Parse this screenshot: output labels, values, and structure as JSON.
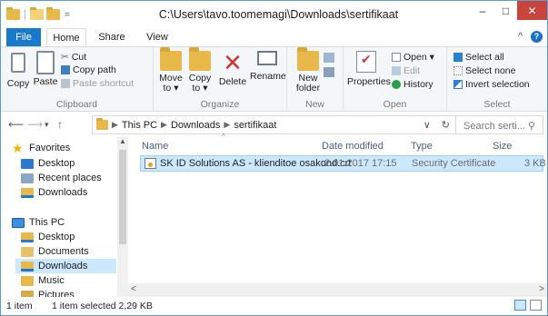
{
  "window": {
    "title": "C:\\Users\\tavo.toomemagi\\Downloads\\sertifikaat",
    "qat_dropdown": "="
  },
  "controls": {
    "minimize": "–",
    "maximize": "□",
    "close": "✕"
  },
  "ribbon_tabs": {
    "file": "File",
    "home": "Home",
    "share": "Share",
    "view": "View",
    "collapse": "^",
    "help": "?"
  },
  "ribbon": {
    "clipboard": {
      "caption": "Clipboard",
      "copy": "Copy",
      "paste": "Paste",
      "cut": "Cut",
      "copy_path": "Copy path",
      "paste_shortcut": "Paste shortcut"
    },
    "organize": {
      "caption": "Organize",
      "move_to": "Move to ▾",
      "copy_to": "Copy to ▾",
      "delete": "Delete",
      "rename": "Rename"
    },
    "new": {
      "caption": "New",
      "new_folder": "New folder"
    },
    "open": {
      "caption": "Open",
      "properties": "Properties",
      "open": "Open ▾",
      "edit": "Edit",
      "history": "History"
    },
    "select": {
      "caption": "Select",
      "select_all": "Select all",
      "select_none": "Select none",
      "invert_selection": "Invert selection"
    }
  },
  "address": {
    "back": "⟵",
    "forward": "⟶",
    "recent": "▾",
    "up": "↑",
    "crumbs": [
      "This PC",
      "Downloads",
      "sertifikaat"
    ],
    "dropdown": "∨",
    "refresh": "↻",
    "search_placeholder": "Search serti... ⚲"
  },
  "nav_pane": {
    "favorites": "Favorites",
    "desktop": "Desktop",
    "recent_places": "Recent places",
    "downloads": "Downloads",
    "this_pc": "This PC",
    "pc_desktop": "Desktop",
    "documents": "Documents",
    "pc_downloads": "Downloads",
    "music": "Music",
    "pictures": "Pictures"
  },
  "columns": {
    "name": "Name",
    "date_modified": "Date modified",
    "type": "Type",
    "size": "Size"
  },
  "files": [
    {
      "name": "SK ID Solutions AS - klienditoe osakond.crt",
      "date": "2.01.2017 17:15",
      "type": "Security Certificate",
      "size": "3 KB"
    }
  ],
  "status": {
    "count": "1 item",
    "selected": "1 item selected 2,29 KB"
  },
  "colors": {
    "accent": "#1979ca",
    "selection": "#cce8ff",
    "close": "#c7453b"
  }
}
